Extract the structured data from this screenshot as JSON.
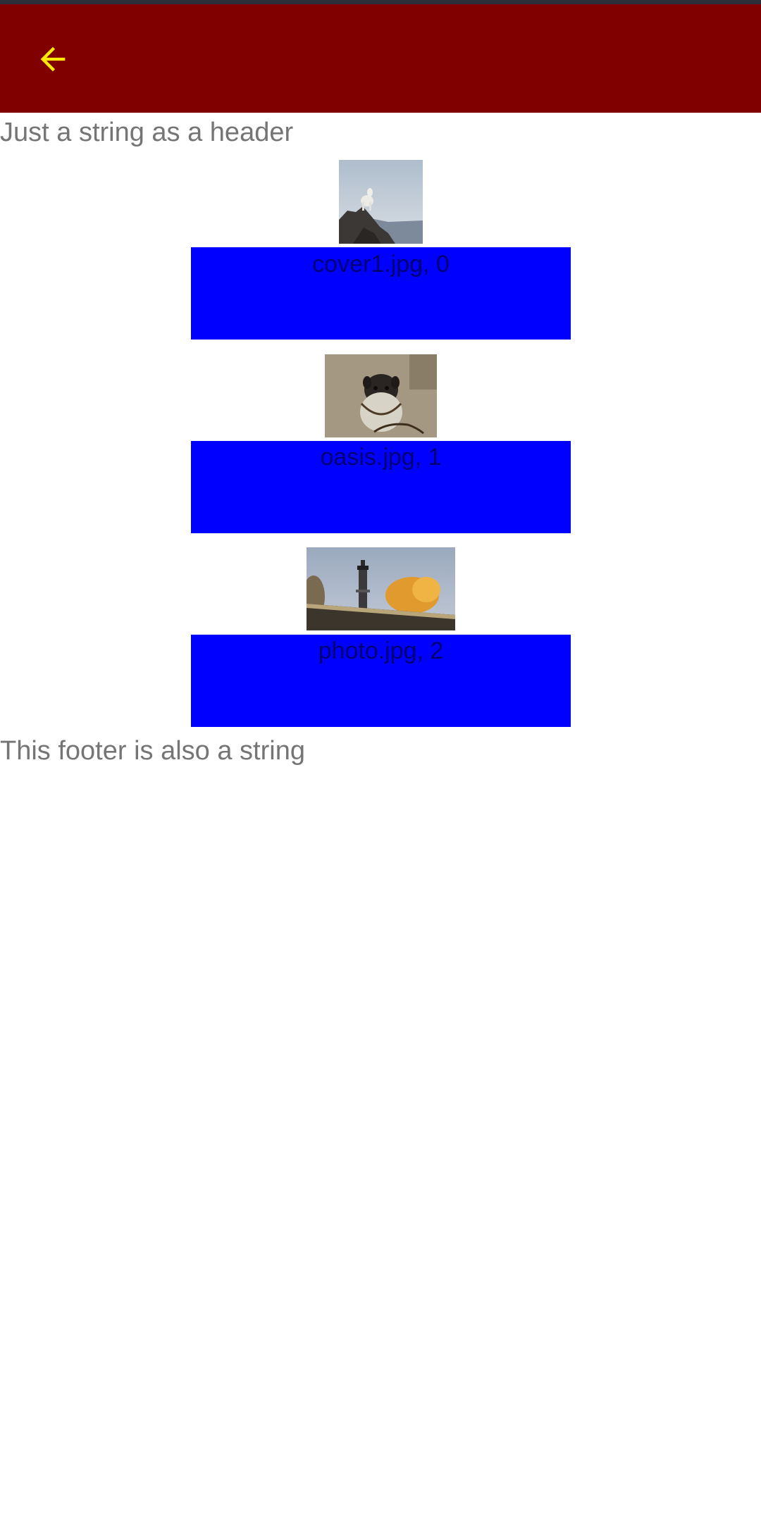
{
  "app_bar": {
    "background": "#800000",
    "back_icon": "arrow-left-icon",
    "back_icon_color": "#ffeb00"
  },
  "list": {
    "header": "Just a string as a header",
    "items": [
      {
        "caption": "cover1.jpg, 0",
        "thumbnail": "mountain-goat-photo"
      },
      {
        "caption": "oasis.jpg, 1",
        "thumbnail": "pug-dog-photo"
      },
      {
        "caption": "photo.jpg, 2",
        "thumbnail": "chimney-autumn-tree-photo"
      }
    ],
    "footer": "This footer is also a string",
    "caption_background": "#0000ff"
  }
}
